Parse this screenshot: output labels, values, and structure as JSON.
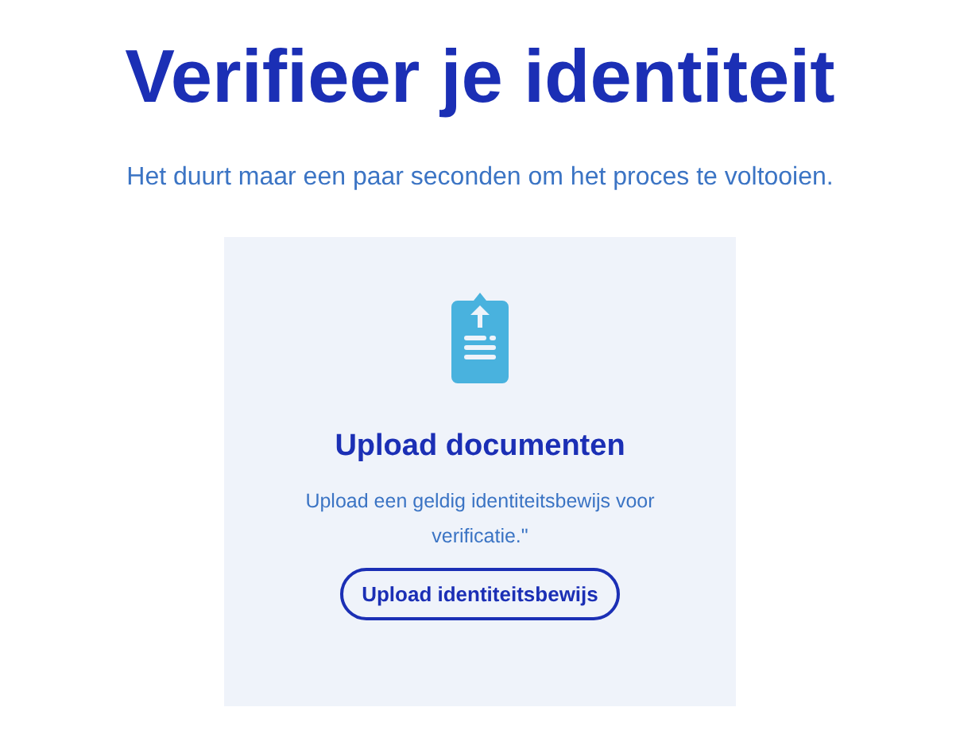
{
  "title": "Verifieer je identiteit",
  "subtitle": "Het duurt maar een paar seconden om het proces te voltooien.",
  "card": {
    "heading": "Upload documenten",
    "description": "Upload een geldig identiteitsbewijs voor verificatie.\"",
    "button": "Upload identiteitsbewijs"
  }
}
